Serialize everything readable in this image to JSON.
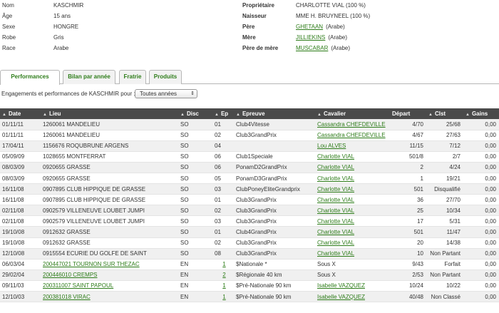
{
  "horse": {
    "left": [
      {
        "label": "Nom",
        "value": "KASCHMIR"
      },
      {
        "label": "Âge",
        "value": "15 ans"
      },
      {
        "label": "Sexe",
        "value": "HONGRE"
      },
      {
        "label": "Robe",
        "value": "Gris"
      },
      {
        "label": "Race",
        "value": "Arabe"
      }
    ],
    "proprietaire": {
      "label": "Propriétaire",
      "value": "CHARLOTTE VIAL (100 %)"
    },
    "naisseur": {
      "label": "Naisseur",
      "value": "MME H. BRUYNEEL (100 %)"
    },
    "pere": {
      "label": "Père",
      "value": "GHETAAN",
      "sub": "(Arabe)"
    },
    "mere": {
      "label": "Mère",
      "value": "JILLIEKINS",
      "sub": "(Arabe)"
    },
    "pere_de_mere": {
      "label": "Père de mère",
      "value": "MUSCABAR",
      "sub": "(Arabe)"
    }
  },
  "tabs": [
    "Performances",
    "Bilan par année",
    "Fratrie",
    "Produits"
  ],
  "filter": {
    "label": "Engagements et performances de KASCHMIR pour :",
    "selected": "Toutes années"
  },
  "columns": [
    "Date",
    "Lieu",
    "Disc",
    "Ep",
    "Epreuve",
    "Cavalier",
    "Départ",
    "Clst",
    "Gains"
  ],
  "rows": [
    {
      "date": "01/11/11",
      "lieu": "1260061 MANDELIEU",
      "disc": "SO",
      "ep": "01",
      "epreuve": "Club4Vitesse",
      "cavalier": "Cassandra CHEFDEVILLE",
      "depart": "4/70",
      "clst": "25/68",
      "gains": "0,00"
    },
    {
      "date": "01/11/11",
      "lieu": "1260061 MANDELIEU",
      "disc": "SO",
      "ep": "02",
      "epreuve": "Club3GrandPrix",
      "cavalier": "Cassandra CHEFDEVILLE",
      "depart": "4/67",
      "clst": "27/63",
      "gains": "0,00"
    },
    {
      "date": "17/04/11",
      "lieu": "1156676 ROQUBRUNE ARGENS",
      "disc": "SO",
      "ep": "04",
      "epreuve": "",
      "cavalier": "Lou ALVES",
      "depart": "11/15",
      "clst": "7/12",
      "gains": "0,00"
    },
    {
      "date": "05/09/09",
      "lieu": "1028655 MONTFERRAT",
      "disc": "SO",
      "ep": "06",
      "epreuve": "Club1Speciale",
      "cavalier": "Charlotte VIAL",
      "depart": "501/8",
      "clst": "2/7",
      "gains": "0,00"
    },
    {
      "date": "08/03/09",
      "lieu": "0920655 GRASSE",
      "disc": "SO",
      "ep": "06",
      "epreuve": "PonamD2GrandPrix",
      "cavalier": "Charlotte VIAL",
      "depart": "2",
      "clst": "4/24",
      "gains": "0,00"
    },
    {
      "date": "08/03/09",
      "lieu": "0920655 GRASSE",
      "disc": "SO",
      "ep": "05",
      "epreuve": "PonamD3GrandPrix",
      "cavalier": "Charlotte VIAL",
      "depart": "1",
      "clst": "19/21",
      "gains": "0,00"
    },
    {
      "date": "16/11/08",
      "lieu": "0907895 CLUB HIPPIQUE DE GRASSE",
      "disc": "SO",
      "ep": "03",
      "epreuve": "ClubPoneyEliteGrandprix",
      "cavalier": "Charlotte VIAL",
      "depart": "501",
      "clst": "Disqualifié",
      "gains": "0,00"
    },
    {
      "date": "16/11/08",
      "lieu": "0907895 CLUB HIPPIQUE DE GRASSE",
      "disc": "SO",
      "ep": "01",
      "epreuve": "Club3GrandPrix",
      "cavalier": "Charlotte VIAL",
      "depart": "36",
      "clst": "27/70",
      "gains": "0,00"
    },
    {
      "date": "02/11/08",
      "lieu": "0902579 VILLENEUVE LOUBET JUMPI",
      "disc": "SO",
      "ep": "02",
      "epreuve": "Club3GrandPrix",
      "cavalier": "Charlotte VIAL",
      "depart": "25",
      "clst": "10/34",
      "gains": "0,00"
    },
    {
      "date": "02/11/08",
      "lieu": "0902579 VILLENEUVE LOUBET JUMPI",
      "disc": "SO",
      "ep": "03",
      "epreuve": "Club3GrandPrix",
      "cavalier": "Charlotte VIAL",
      "depart": "17",
      "clst": "5/31",
      "gains": "0,00"
    },
    {
      "date": "19/10/08",
      "lieu": "0912632 GRASSE",
      "disc": "SO",
      "ep": "01",
      "epreuve": "Club4GrandPrix",
      "cavalier": "Charlotte VIAL",
      "depart": "501",
      "clst": "11/47",
      "gains": "0,00"
    },
    {
      "date": "19/10/08",
      "lieu": "0912632 GRASSE",
      "disc": "SO",
      "ep": "02",
      "epreuve": "Club3GrandPrix",
      "cavalier": "Charlotte VIAL",
      "depart": "20",
      "clst": "14/38",
      "gains": "0,00"
    },
    {
      "date": "12/10/08",
      "lieu": "0915554 ECURIE DU GOLFE DE SAINT",
      "disc": "SO",
      "ep": "08",
      "epreuve": "Club3GrandPrix",
      "cavalier": "Charlotte VIAL",
      "depart": "10",
      "clst": "Non Partant",
      "gains": "0,00"
    },
    {
      "date": "06/03/04",
      "lieu": "200447021 TOURNON SUR THEZAC",
      "disc": "EN",
      "ep": "1",
      "epreuve": "$Nationale *",
      "cavalier": "Sous X",
      "depart": "9/43",
      "clst": "Forfait",
      "gains": "0,00"
    },
    {
      "date": "29/02/04",
      "lieu": "200446010 CREMPS",
      "disc": "EN",
      "ep": "2",
      "epreuve": "$Régionale 40 km",
      "cavalier": "Sous X",
      "depart": "2/53",
      "clst": "Non Partant",
      "gains": "0,00"
    },
    {
      "date": "09/11/03",
      "lieu": "200311007 SAINT PAPOUL",
      "disc": "EN",
      "ep": "1",
      "epreuve": "$Pré-Nationale 90 km",
      "cavalier": "Isabelle VAZQUEZ",
      "depart": "10/24",
      "clst": "10/22",
      "gains": "0,00"
    },
    {
      "date": "12/10/03",
      "lieu": "200381018 VIRAC",
      "disc": "EN",
      "ep": "1",
      "epreuve": "$Pré-Nationale 90 km",
      "cavalier": "Isabelle VAZQUEZ",
      "depart": "40/48",
      "clst": "Non Classé",
      "gains": "0,00"
    }
  ]
}
